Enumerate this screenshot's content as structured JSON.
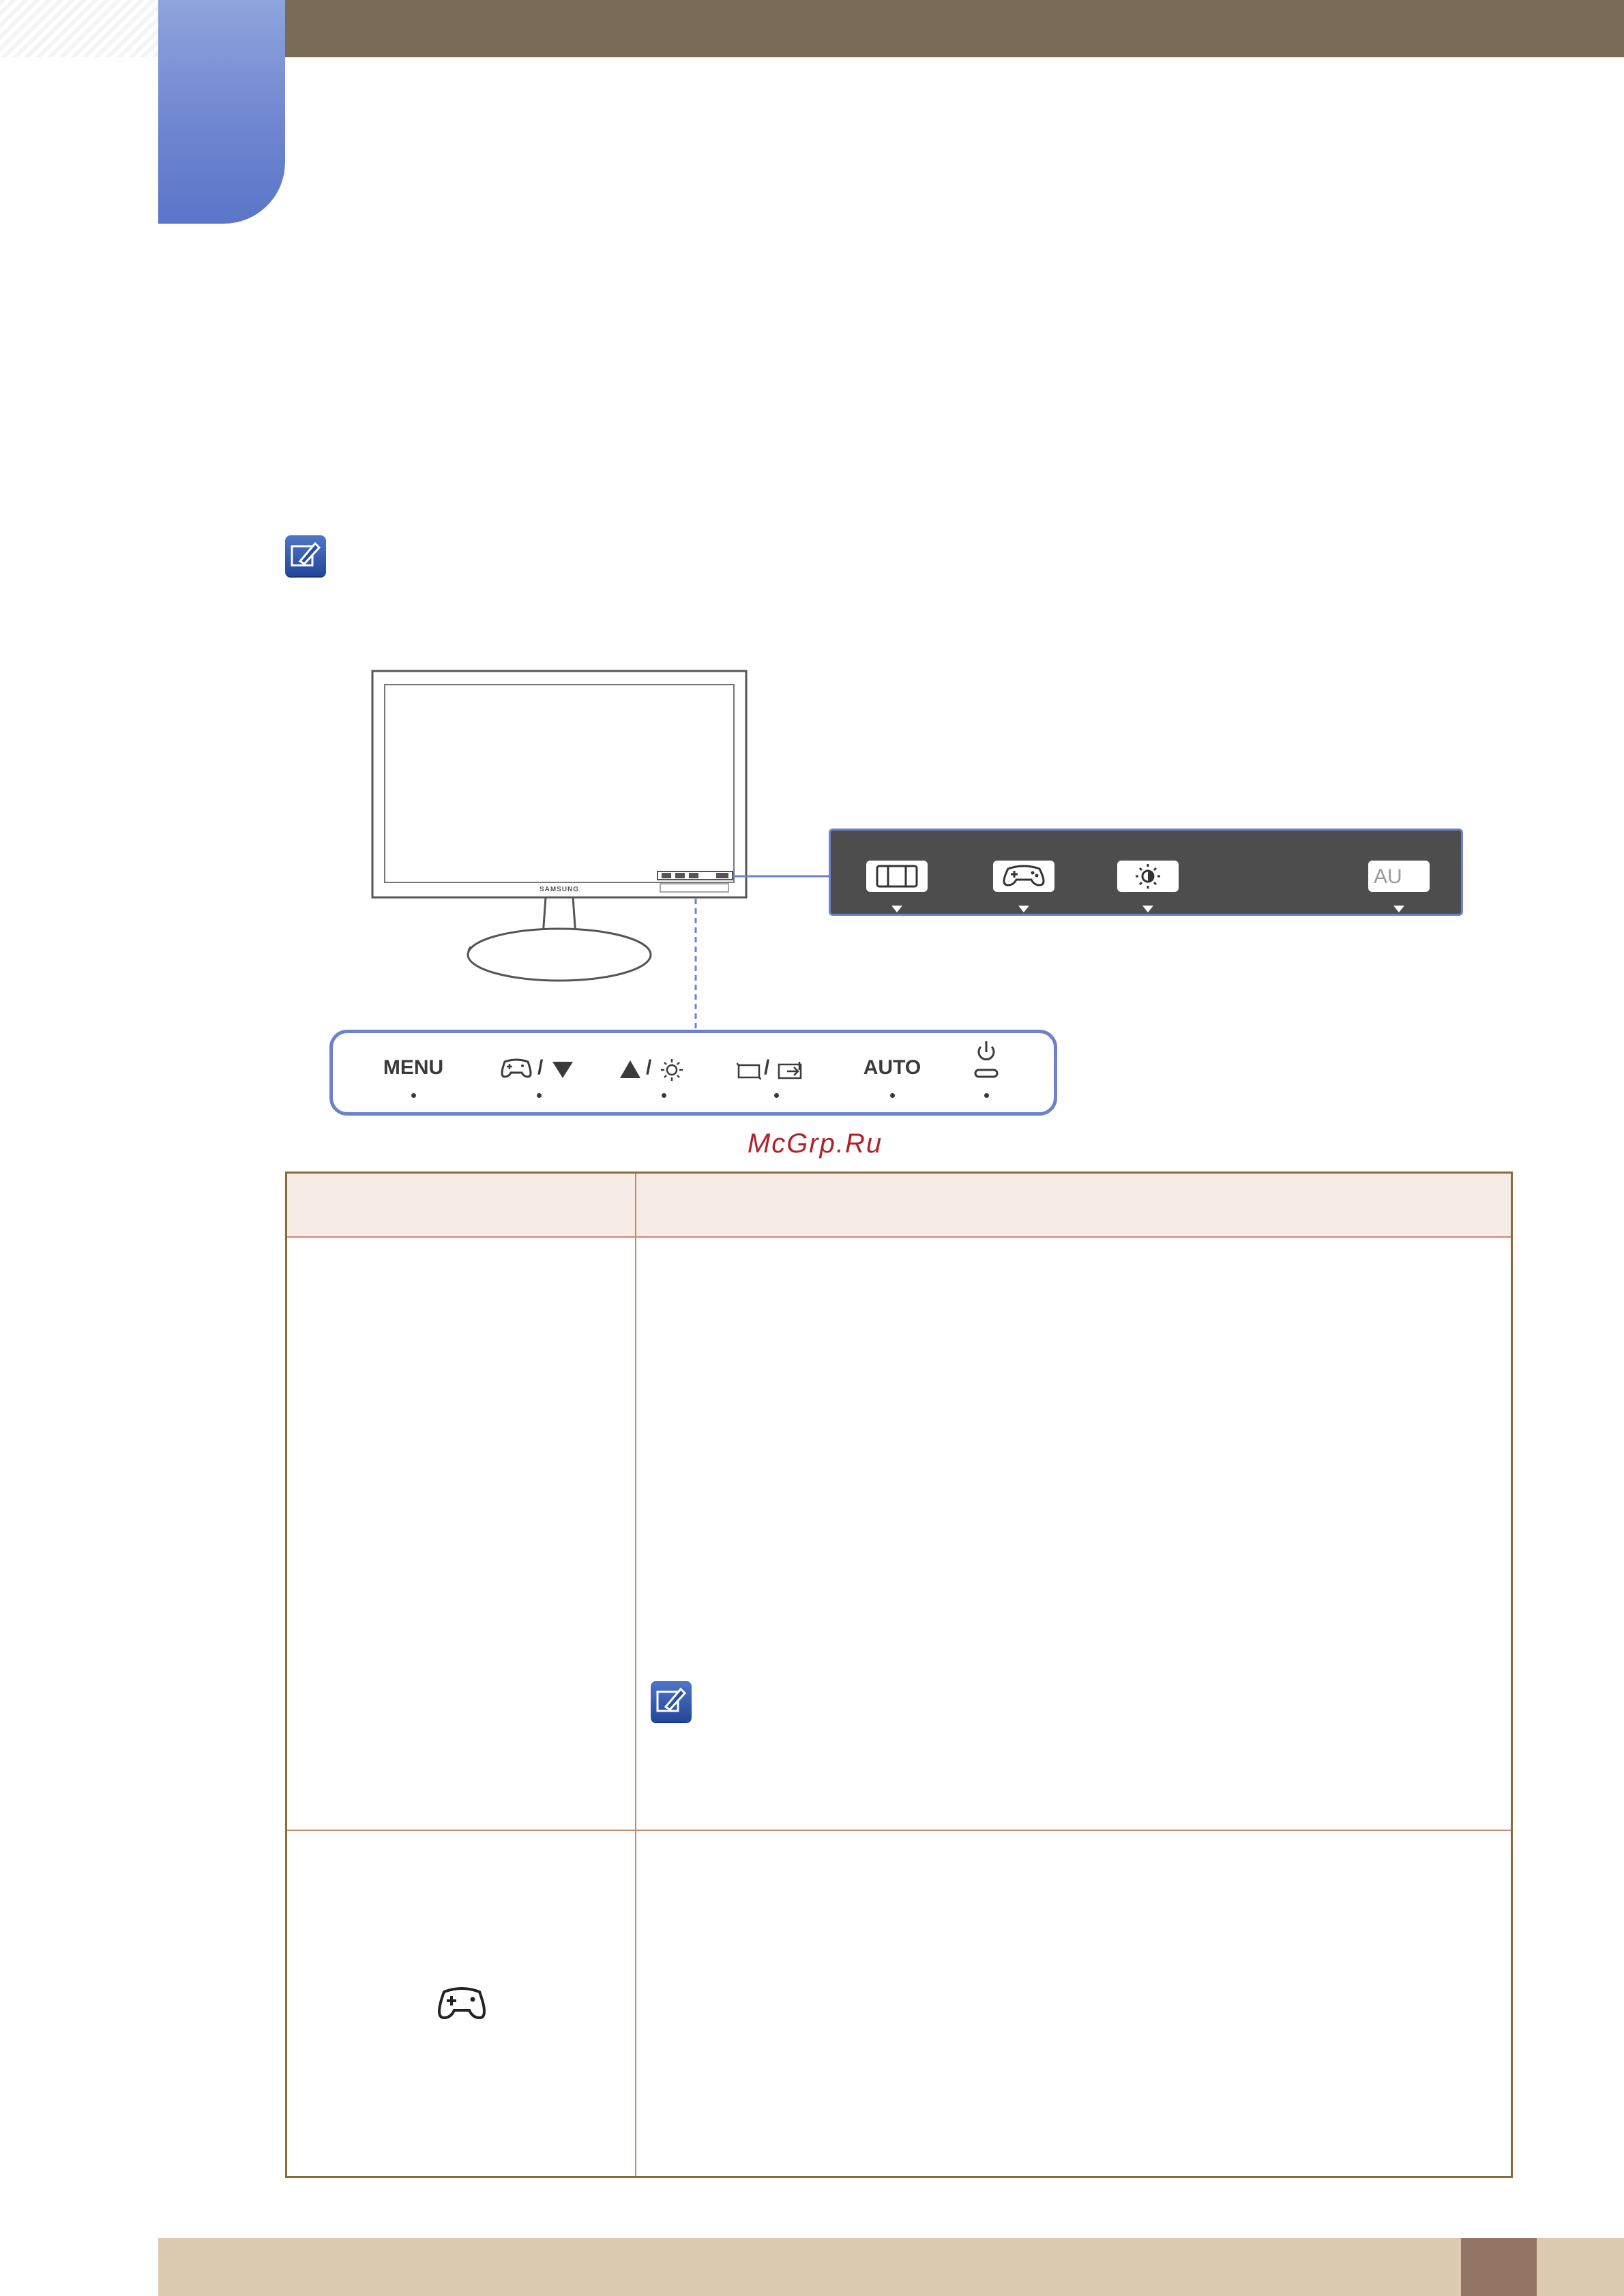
{
  "monitor": {
    "brand_label": "SAMSUNG"
  },
  "front_buttons": [
    {
      "id": "menu",
      "label": "MENU"
    },
    {
      "id": "game-down",
      "label": "/"
    },
    {
      "id": "up-brightness",
      "label": "/"
    },
    {
      "id": "source-enter",
      "label": "/"
    },
    {
      "id": "auto",
      "label": "AUTO"
    },
    {
      "id": "power",
      "label": ""
    }
  ],
  "osd_guide": {
    "items": [
      "menu-icon",
      "game-icon",
      "brightness-icon",
      "AU"
    ],
    "auto_label": "AU"
  },
  "watermark": "McGrp.Ru",
  "colors": {
    "header_band": "#7a6a58",
    "chapter_tab": "#6f87d1",
    "accent_border": "#6b82cc",
    "table_border": "#8a6a3a",
    "table_header_bg": "#f7ebe6",
    "footer_band": "#dccab0",
    "page_box": "#927565",
    "watermark": "#b0222a"
  }
}
